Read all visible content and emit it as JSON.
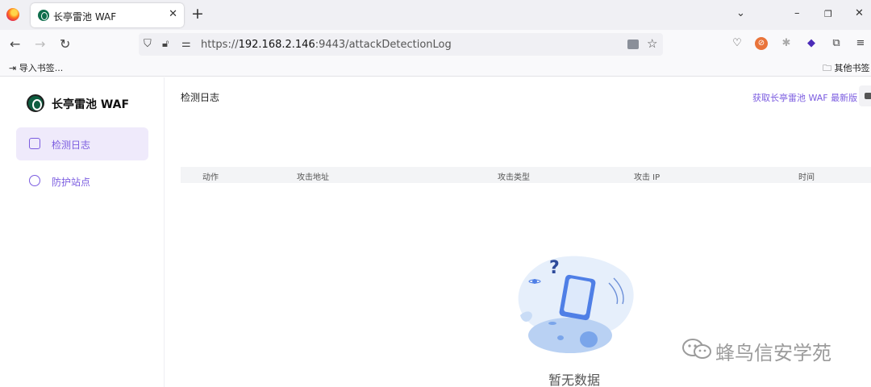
{
  "browser": {
    "tab": {
      "title": "长亭雷池 WAF"
    },
    "url": {
      "scheme": "https://",
      "host": "192.168.2.146",
      "rest": ":9443/attackDetectionLog"
    },
    "bookmarks": {
      "import_label": "导入书签...",
      "other_label": "其他书签"
    }
  },
  "app": {
    "brand": "长亭雷池 WAF",
    "menu": [
      {
        "label": "检测日志",
        "active": true
      },
      {
        "label": "防护站点",
        "active": false
      }
    ],
    "page_title": "检测日志",
    "latest_link": "获取长亭雷池 WAF 最新版",
    "table": {
      "columns": [
        "动作",
        "攻击地址",
        "攻击类型",
        "攻击 IP",
        "时间"
      ]
    },
    "empty_text": "暂无数据"
  },
  "watermark": {
    "text": "蜂鸟信安学苑"
  },
  "colors": {
    "accent": "#7b5ce0",
    "active_bg": "#efeafb",
    "header_bg": "#f3f4f6"
  }
}
